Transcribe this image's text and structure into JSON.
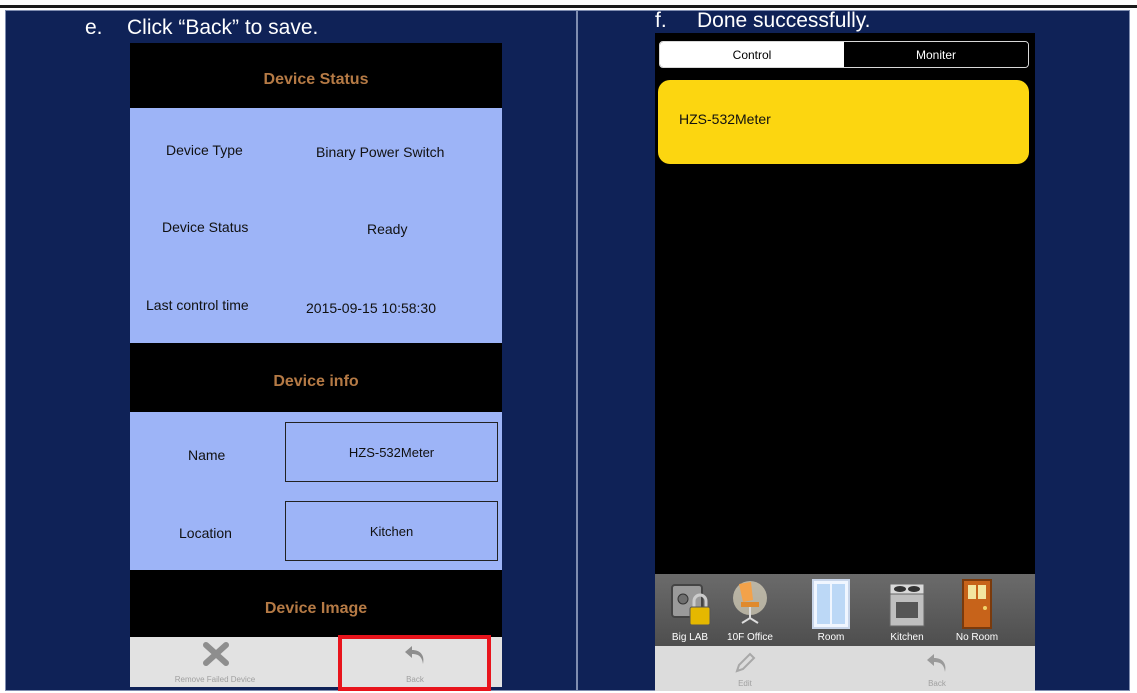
{
  "left_panel": {
    "step_letter": "e.",
    "step_text": "Click “Back” to save.",
    "device_status": {
      "header": "Device Status",
      "rows": [
        {
          "label": "Device Type",
          "value": "Binary Power Switch"
        },
        {
          "label": "Device Status",
          "value": "Ready"
        },
        {
          "label": "Last control time",
          "value": "2015-09-15 10:58:30"
        }
      ]
    },
    "device_info": {
      "header": "Device info",
      "name_label": "Name",
      "name_value": "HZS-532Meter",
      "location_label": "Location",
      "location_value": "Kitchen"
    },
    "device_image_header": "Device Image",
    "toolbar": {
      "remove_label": "Remove Failed Device",
      "back_label": "Back"
    },
    "highlight_color": "#e8141c"
  },
  "right_panel": {
    "step_letter": "f.",
    "step_text": "Done successfully.",
    "tabs": [
      {
        "label": "Control",
        "active": true
      },
      {
        "label": "Moniter",
        "active": false
      }
    ],
    "device_card": {
      "name": "HZS-532Meter",
      "color": "#fcd610"
    },
    "rooms": [
      {
        "label": "Big LAB",
        "icon": "safe-lock-icon"
      },
      {
        "label": "10F Office",
        "icon": "office-chair-icon"
      },
      {
        "label": "Room",
        "icon": "window-icon"
      },
      {
        "label": "Kitchen",
        "icon": "stove-icon"
      },
      {
        "label": "No Room",
        "icon": "door-icon"
      }
    ],
    "toolbar": {
      "edit_label": "Edit",
      "back_label": "Back"
    }
  }
}
